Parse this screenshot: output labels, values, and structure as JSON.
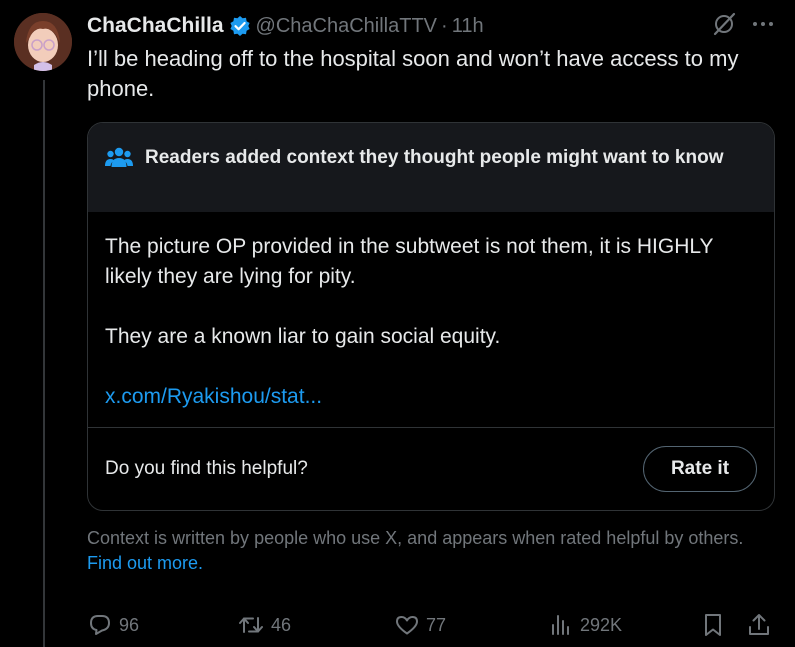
{
  "user": {
    "display_name": "ChaChaChilla",
    "handle": "@ChaChaChillaTTV",
    "separator": "·",
    "time": "11h"
  },
  "tweet": {
    "text": "I’ll be heading off to the hospital soon and won’t have access to my phone."
  },
  "community_note": {
    "header": "Readers added context they thought people might want to know",
    "paragraph_1": "The picture OP provided in the subtweet is not them, it is HIGHLY likely they are lying for pity.",
    "paragraph_2": "They are a known liar to gain social equity.",
    "link": "x.com/Ryakishou/stat...",
    "helpful_question": "Do you find this helpful?",
    "rate_button": "Rate it"
  },
  "context_info": {
    "text": "Context is written by people who use X, and appears when rated helpful by others.",
    "link": "Find out more."
  },
  "actions": {
    "replies": "96",
    "reposts": "46",
    "likes": "77",
    "views": "292K"
  },
  "colors": {
    "background": "#000000",
    "text": "#e7e9ea",
    "muted": "#71767b",
    "accent": "#1d9bf0",
    "border": "#2f3336"
  },
  "icons": [
    "verified-badge-icon",
    "grok-icon",
    "more-icon",
    "readers-icon",
    "reply-icon",
    "repost-icon",
    "like-icon",
    "views-icon",
    "bookmark-icon",
    "share-icon"
  ]
}
